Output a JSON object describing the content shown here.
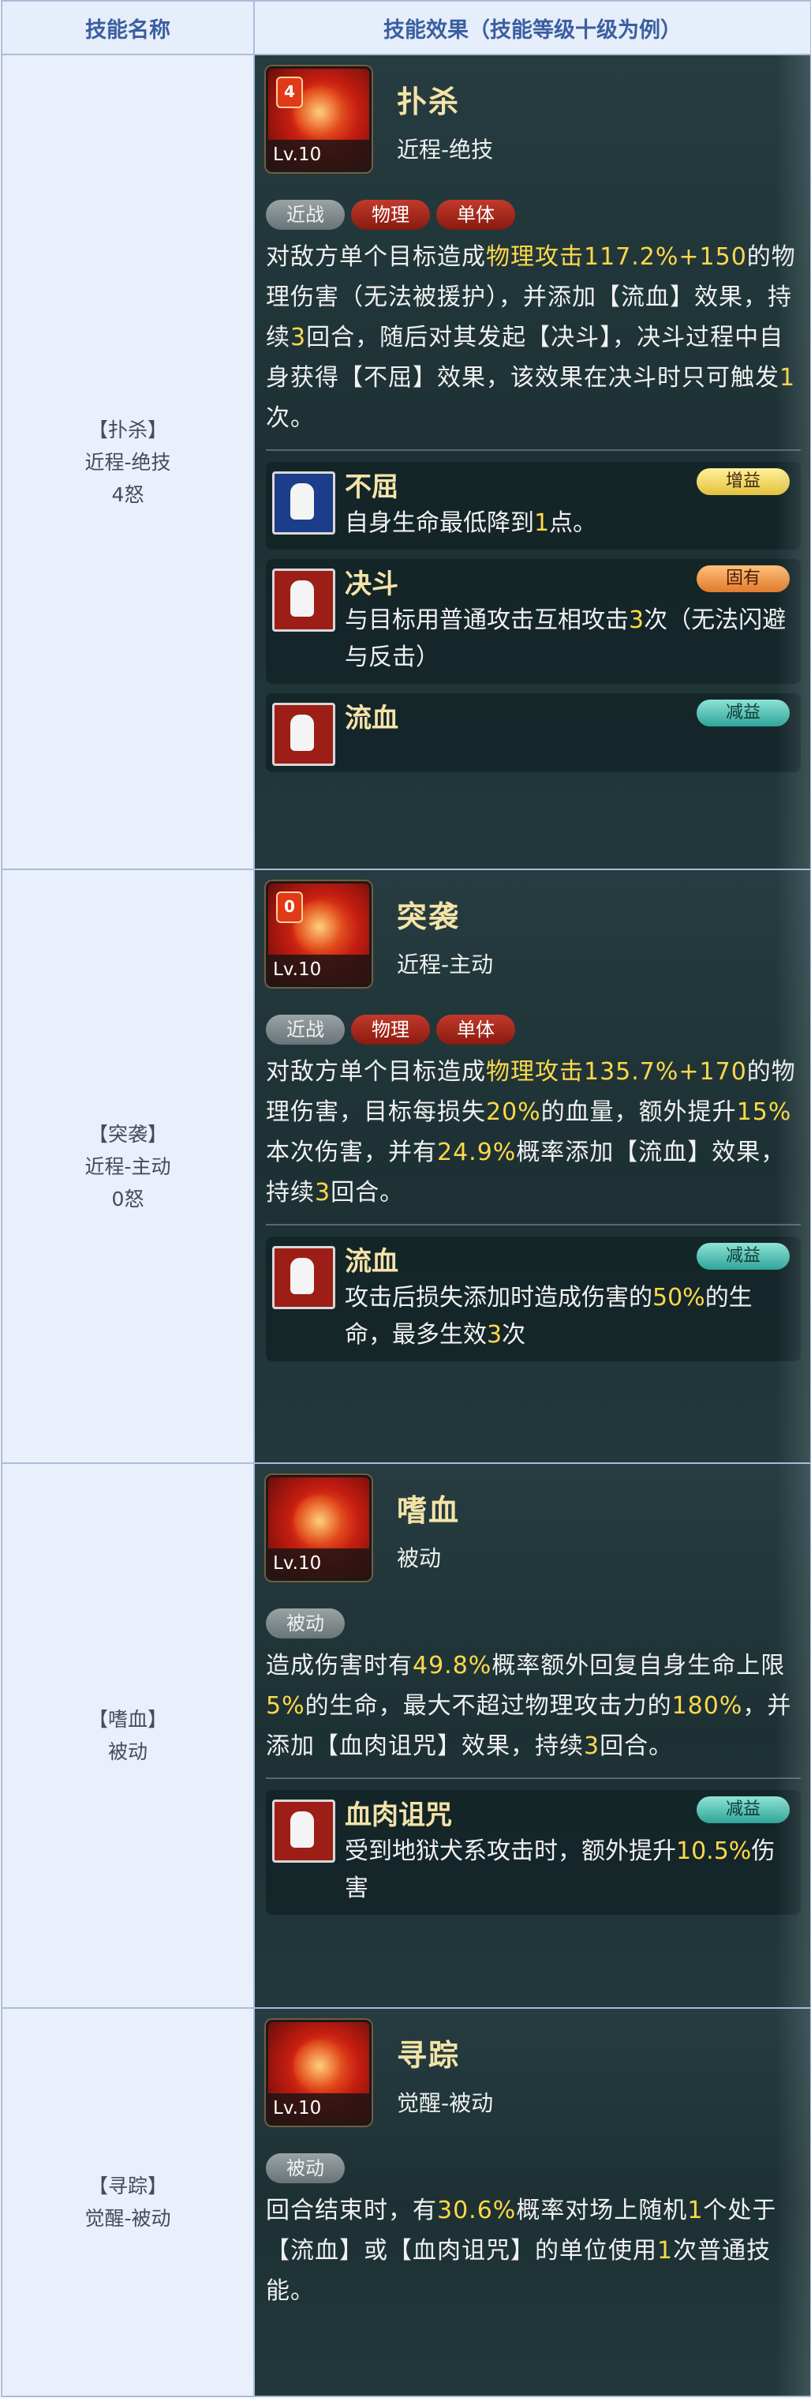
{
  "headers": {
    "name_col": "技能名称",
    "effect_col": "技能效果（技能等级十级为例）"
  },
  "skills": [
    {
      "name_lines": [
        "【扑杀】",
        "近程-绝技",
        "4怒"
      ],
      "cost": "4",
      "level": "Lv.10",
      "title": "扑杀",
      "type": "近程-绝技",
      "tags": [
        "近战",
        "物理",
        "单体"
      ],
      "desc": [
        [
          "对敌方单个目标造成",
          "物理攻击117.2%+150",
          "的物理伤害（无法被援护），并添加【流血】效果，持续",
          "3",
          "回合，随后对其发起【决斗】，决斗过程中自身获得【不屈】效果，该效果在决斗时只可触发",
          "1",
          "次。"
        ]
      ],
      "effects": [
        {
          "name": "不屈",
          "badge": "增益",
          "badge_color": "#e4c13a",
          "icon": "muscle-icon",
          "text": [
            "自身生命最低降到",
            "1",
            "点。"
          ]
        },
        {
          "name": "决斗",
          "badge": "固有",
          "badge_color": "#e07b2b",
          "icon": "duel-icon",
          "text": [
            "与目标用普通攻击互相攻击",
            "3",
            "次（无法闪避与反击）"
          ]
        },
        {
          "name": "流血",
          "badge": "减益",
          "badge_color": "#2fa59a",
          "icon": "blood-icon",
          "text": []
        }
      ]
    },
    {
      "name_lines": [
        "【突袭】",
        "近程-主动",
        "0怒"
      ],
      "cost": "0",
      "level": "Lv.10",
      "title": "突袭",
      "type": "近程-主动",
      "tags": [
        "近战",
        "物理",
        "单体"
      ],
      "desc": [
        [
          "对敌方单个目标造成",
          "物理攻击135.7%+170",
          "的物理伤害，目标每损失",
          "20%",
          "的血量，额外提升",
          "15%",
          "本次伤害，并有",
          "24.9%",
          "概率添加【流血】效果，持续",
          "3",
          "回合。"
        ]
      ],
      "effects": [
        {
          "name": "流血",
          "badge": "减益",
          "badge_color": "#2fa59a",
          "icon": "blood-icon",
          "text": [
            "攻击后损失添加时造成伤害的",
            "50%",
            "的生命，最多生效",
            "3",
            "次"
          ]
        }
      ]
    },
    {
      "name_lines": [
        "【嗜血】",
        "被动"
      ],
      "cost": "",
      "level": "Lv.10",
      "title": "嗜血",
      "type": "被动",
      "tags": [
        "被动"
      ],
      "desc": [
        [
          "造成伤害时有",
          "49.8%",
          "概率额外回复自身生命上限",
          "5%",
          "的生命，最大不超过物理攻击力的",
          "180%",
          "，并添加【血肉诅咒】效果，持续",
          "3",
          "回合。"
        ]
      ],
      "effects": [
        {
          "name": "血肉诅咒",
          "badge": "减益",
          "badge_color": "#2fa59a",
          "icon": "curse-icon",
          "text": [
            "受到地狱犬系攻击时，额外提升",
            "10.5%",
            "伤害"
          ]
        }
      ]
    },
    {
      "name_lines": [
        "【寻踪】",
        "觉醒-被动"
      ],
      "cost": "",
      "level": "Lv.10",
      "title": "寻踪",
      "type": "觉醒-被动",
      "tags": [
        "被动"
      ],
      "desc": [
        [
          "回合结束时，有",
          "30.6%",
          "概率对场上随机",
          "1",
          "个处于【流血】或【血肉诅咒】的单位使用",
          "1",
          "次普通技能。"
        ]
      ],
      "effects": []
    }
  ]
}
